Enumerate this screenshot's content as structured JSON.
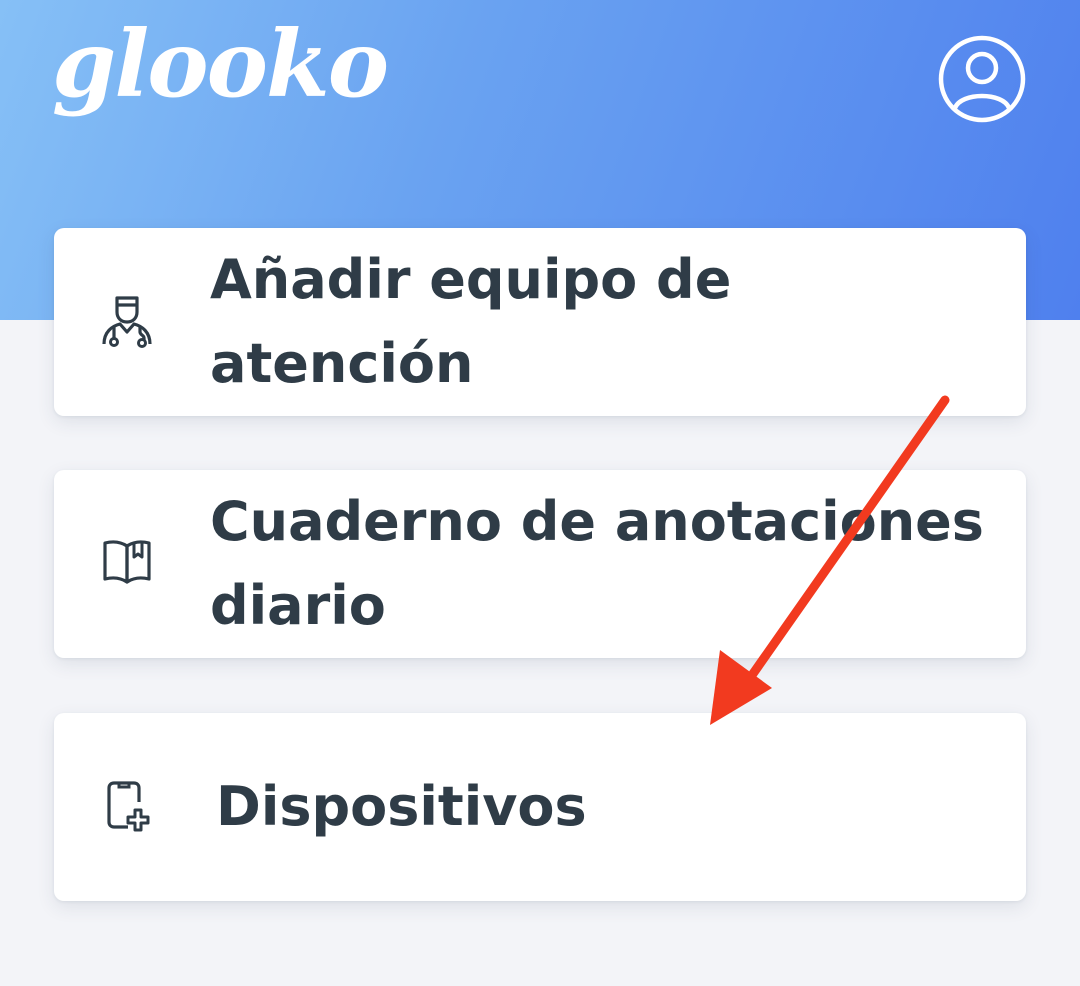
{
  "header": {
    "logo_text": "glooko",
    "profile_icon": "user-circle-icon",
    "gradient_colors": [
      "#86c0f6",
      "#4f80ee"
    ]
  },
  "menu": {
    "items": [
      {
        "label": "Añadir equipo de atención",
        "icon": "care-team-doctor-icon"
      },
      {
        "label": "Cuaderno de anotaciones diario",
        "icon": "logbook-book-icon"
      },
      {
        "label": "Dispositivos",
        "icon": "device-plus-icon"
      }
    ]
  },
  "colors": {
    "text": "#2f3c47",
    "background": "#f3f4f8",
    "card": "#ffffff",
    "annotation_arrow": "#f23a1f"
  }
}
